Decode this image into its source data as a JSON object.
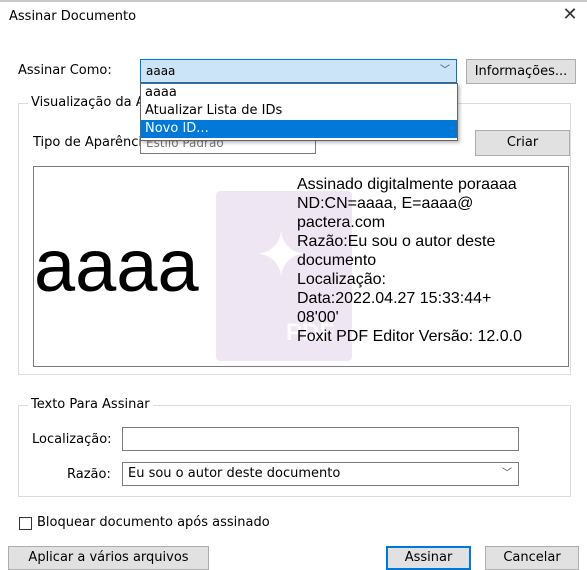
{
  "dialog": {
    "title": "Assinar Documento"
  },
  "sign_as": {
    "label": "Assinar Como:",
    "value": "aaaa",
    "info_button": "Informações...",
    "dropdown_options": [
      "aaaa",
      "Atualizar Lista de IDs",
      "Novo ID..."
    ],
    "selected_option": "Novo ID..."
  },
  "appearance": {
    "legend": "Visualização da A",
    "type_label": "Tipo de Aparência:",
    "type_value": "Estilo Padrão",
    "create_button": "Criar"
  },
  "signature_preview": {
    "name": "aaaa",
    "lines": [
      "Assinado digitalmente poraaaa",
      "ND:CN=aaaa, E=aaaa@",
      "pactera.com",
      "Razão:Eu sou o autor deste",
      "documento",
      "Localização:",
      "Data:2022.04.27 15:33:44+",
      "08'00'",
      "Foxit PDF Editor Versão: 12.0.0"
    ],
    "watermark_text": "PDF"
  },
  "text_to_sign": {
    "legend": "Texto Para Assinar",
    "location_label": "Localização:",
    "location_value": "",
    "reason_label": "Razão:",
    "reason_value": "Eu sou o autor deste documento"
  },
  "options": {
    "lock_label": "Bloquear documento após assinado",
    "lock_checked": false
  },
  "footer": {
    "apply_multiple_button": "Aplicar a vários arquivos",
    "sign_button": "Assinar",
    "cancel_button": "Cancelar"
  },
  "colors": {
    "accent": "#0078d7",
    "highlight": "#cce4f7",
    "watermark": "#efe6f3"
  }
}
